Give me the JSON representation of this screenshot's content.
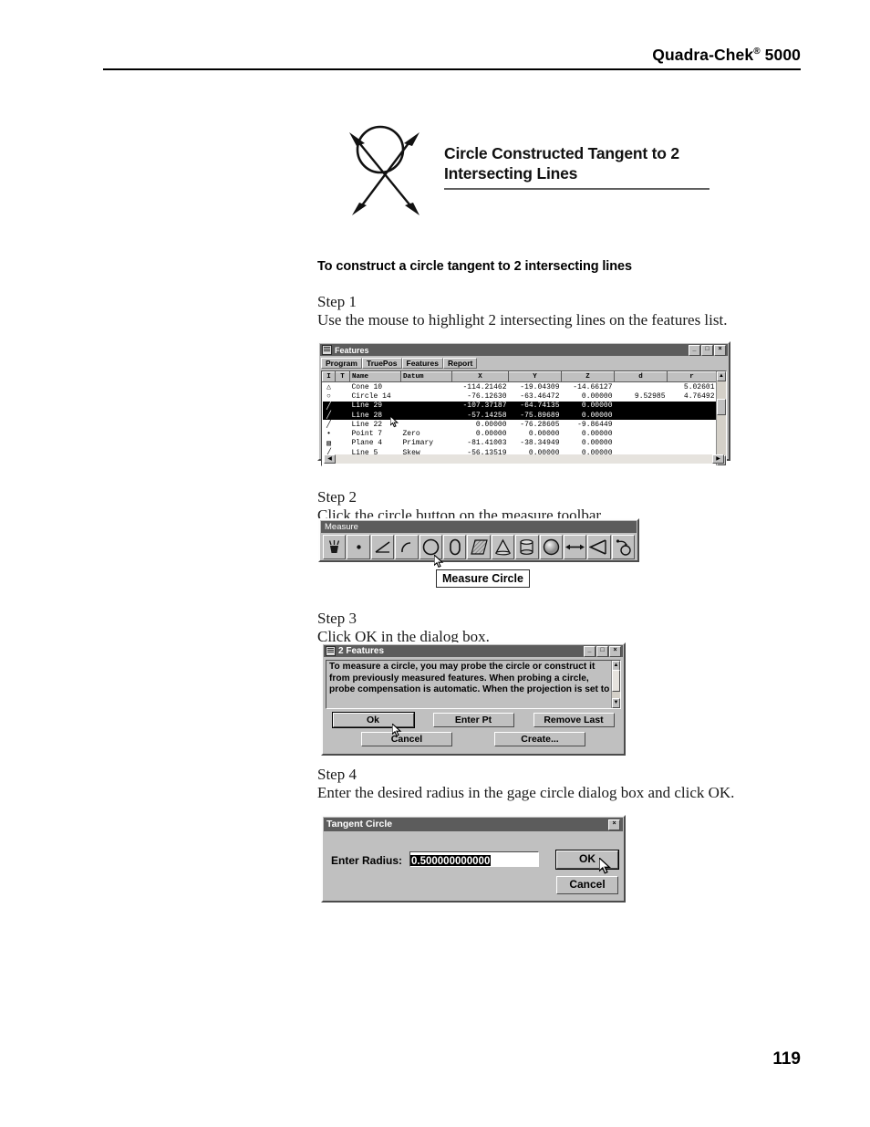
{
  "header": {
    "title_main": "Quadra-Chek",
    "title_sup": "®",
    "title_model": " 5000"
  },
  "figure": {
    "heading_line1": "Circle Constructed Tangent to 2",
    "heading_line2": "Intersecting Lines",
    "art_name": "circle-tangent-two-lines-diagram"
  },
  "section_heading": "To construct a circle tangent to 2 intersecting lines",
  "steps": [
    {
      "label": "Step 1",
      "text": "Use the mouse to highlight 2 intersecting lines on the features list."
    },
    {
      "label": "Step 2",
      "text": "Click the circle button on the measure toolbar."
    },
    {
      "label": "Step 3",
      "text": "Click OK in the dialog box."
    },
    {
      "label": "Step 4",
      "text": "Enter the desired radius in the gage circle dialog box and click OK."
    }
  ],
  "page_number": "119",
  "features_window": {
    "title": "Features",
    "window_buttons": [
      "_",
      "□",
      "×"
    ],
    "menu": [
      "Program",
      "TruePos",
      "Features",
      "Report"
    ],
    "columns": [
      "I",
      "T",
      "Name",
      "Datum",
      "X",
      "Y",
      "Z",
      "d",
      "r"
    ],
    "rows": [
      {
        "icon": "cone-icon",
        "t": "",
        "name": "Cone 10",
        "datum": "",
        "x": "-114.21462",
        "y": "-19.04309",
        "z": "-14.66127",
        "d": "",
        "r": "5.02601",
        "selected": false
      },
      {
        "icon": "circle-icon",
        "t": "",
        "name": "Circle 14",
        "datum": "",
        "x": "-76.12630",
        "y": "-63.46472",
        "z": "0.00000",
        "d": "9.52985",
        "r": "4.76492",
        "selected": false
      },
      {
        "icon": "line-icon",
        "t": "",
        "name": "Line 29",
        "datum": "",
        "x": "-107.37187",
        "y": "-64.74135",
        "z": "0.00000",
        "d": "",
        "r": "",
        "selected": true
      },
      {
        "icon": "line-icon",
        "t": "",
        "name": "Line 28",
        "datum": "",
        "x": "-57.14258",
        "y": "-75.89689",
        "z": "0.00000",
        "d": "",
        "r": "",
        "selected": true
      },
      {
        "icon": "line-icon",
        "t": "",
        "name": "Line 22",
        "datum": "",
        "x": "0.00000",
        "y": "-76.28605",
        "z": "-9.86449",
        "d": "",
        "r": "",
        "selected": false
      },
      {
        "icon": "point-icon",
        "t": "",
        "name": "Point 7",
        "datum": "Zero",
        "x": "0.00000",
        "y": "0.00000",
        "z": "0.00000",
        "d": "",
        "r": "",
        "selected": false
      },
      {
        "icon": "plane-icon",
        "t": "",
        "name": "Plane 4",
        "datum": "Primary",
        "x": "-81.41003",
        "y": "-38.34949",
        "z": "0.00000",
        "d": "",
        "r": "",
        "selected": false
      },
      {
        "icon": "line-icon",
        "t": "",
        "name": "Line 5",
        "datum": "Skew",
        "x": "-56.13519",
        "y": "0.00000",
        "z": "0.00000",
        "d": "",
        "r": "",
        "selected": false
      }
    ]
  },
  "measure_toolbar": {
    "caption": "Measure",
    "buttons": [
      "magic-wand-icon",
      "point-icon",
      "line-icon",
      "arc-icon",
      "circle-icon",
      "slot-icon",
      "plane-icon",
      "cone-icon",
      "cylinder-icon",
      "sphere-icon",
      "distance-icon",
      "angle-icon",
      "skew-icon"
    ],
    "tooltip": "Measure Circle"
  },
  "features_dialog": {
    "title": "2 Features",
    "window_buttons": [
      "_",
      "□",
      "×"
    ],
    "message_lines": [
      "To measure a circle, you may probe the circle or construct it",
      "from previously measured features.  When probing a circle,",
      "probe compensation is automatic.  When the projection is set to"
    ],
    "buttons_row1": [
      "Ok",
      "Enter Pt",
      "Remove Last"
    ],
    "buttons_row2": [
      "Cancel",
      "Create..."
    ]
  },
  "tangent_circle_dialog": {
    "title": "Tangent Circle",
    "close_button": "×",
    "radius_label": "Enter Radius:",
    "radius_value": "0.500000000000",
    "ok_label": "OK",
    "cancel_label": "Cancel"
  },
  "colors": {
    "page_bg": "#ffffff",
    "win_face": "#c0c0c0",
    "titlebar": "#5c5c5c",
    "selection": "#000000",
    "text": "#000000"
  }
}
